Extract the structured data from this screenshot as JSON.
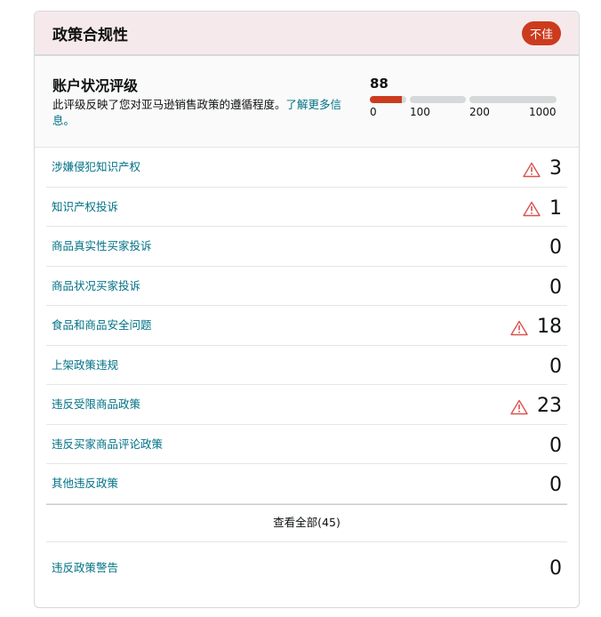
{
  "header": {
    "title": "政策合规性",
    "badge": "不佳"
  },
  "rating": {
    "title": "账户状况评级",
    "description": "此评级反映了您对亚马逊销售政策的遵循程度。",
    "link": "了解更多信息。",
    "score": "88",
    "score_value": 88,
    "ticks": [
      "0",
      "100",
      "200",
      "1000"
    ],
    "accent": "#cc3b1d"
  },
  "rows": [
    {
      "label": "涉嫌侵犯知识产权",
      "value": "3",
      "warning": true
    },
    {
      "label": "知识产权投诉",
      "value": "1",
      "warning": true
    },
    {
      "label": "商品真实性买家投诉",
      "value": "0",
      "warning": false
    },
    {
      "label": "商品状况买家投诉",
      "value": "0",
      "warning": false
    },
    {
      "label": "食品和商品安全问题",
      "value": "18",
      "warning": true
    },
    {
      "label": "上架政策违规",
      "value": "0",
      "warning": false
    },
    {
      "label": "违反受限商品政策",
      "value": "23",
      "warning": true
    },
    {
      "label": "违反买家商品评论政策",
      "value": "0",
      "warning": false
    },
    {
      "label": "其他违反政策",
      "value": "0",
      "warning": false
    }
  ],
  "view_all": "查看全部(45)",
  "policy_warning": {
    "label": "违反政策警告",
    "value": "0"
  }
}
